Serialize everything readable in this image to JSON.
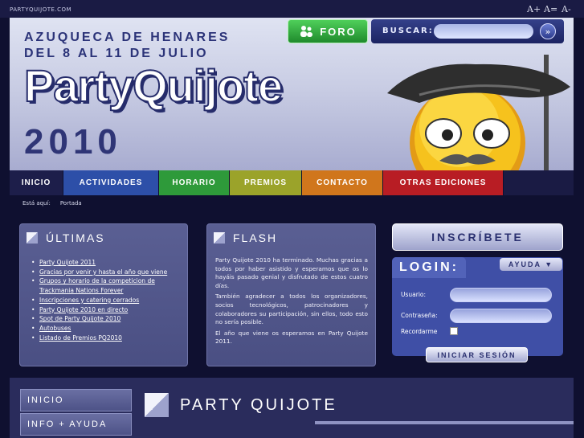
{
  "topbar": {
    "url": "PARTYQUIJOTE.COM",
    "font_size_controls": [
      "A+",
      "A=",
      "A-"
    ]
  },
  "header": {
    "tagline_line1": "AZUQUECA DE HENARES",
    "tagline_line2": "DEL 8 AL 11 DE JULIO",
    "logo": "PartyQuijote",
    "year": "2010",
    "foro_label": "FORO",
    "search_label": "BUSCAR:",
    "search_placeholder": "",
    "search_go": "»"
  },
  "nav": {
    "items": [
      {
        "label": "INICIO",
        "color": "#1d1e4a"
      },
      {
        "label": "ACTIVIDADES",
        "color": "#2d4fa8"
      },
      {
        "label": "HORARIO",
        "color": "#2e9a3a"
      },
      {
        "label": "PREMIOS",
        "color": "#9ba32a"
      },
      {
        "label": "CONTACTO",
        "color": "#d0761c"
      },
      {
        "label": "OTRAS EDICIONES",
        "color": "#b81d24"
      }
    ]
  },
  "breadcrumb": {
    "prefix": "Está aquí:",
    "current": "Portada"
  },
  "ultimas": {
    "title": "ÚLTIMAS",
    "items": [
      "Party Quijote 2011",
      "Gracias por venir y hasta el año que viene",
      "Grupos y horario de la competicion de Trackmania Nations Forever",
      "Inscripciones y catering cerrados",
      "Party Quijote 2010 en directo",
      "Spot de Party Quijote 2010",
      "Autobuses",
      "Listado de Premios PQ2010"
    ]
  },
  "flash": {
    "title": "FLASH",
    "paragraphs": [
      "Party Quijote 2010 ha terminado. Muchas gracias a todos por haber asistido y esperamos que os lo hayáis pasado genial y disfrutado de estos cuatro días.",
      "También agradecer a todos los organizadores, socios tecnológicos, patrocinadores y colaboradores su participación, sin ellos, todo esto no sería posible.",
      "El año que viene os esperamos en Party Quijote 2011."
    ]
  },
  "inscribete_label": "INSCRÍBETE",
  "login": {
    "title": "LOGIN:",
    "ayuda_label": "AYUDA ▼",
    "usuario_label": "Usuario:",
    "contrasena_label": "Contraseña:",
    "recordarme_label": "Recordarme",
    "submit_label": "INICIAR SESIÓN"
  },
  "sidebar": {
    "items": [
      "INICIO",
      "INFO + AYUDA"
    ]
  },
  "content_title": "PARTY QUIJOTE"
}
